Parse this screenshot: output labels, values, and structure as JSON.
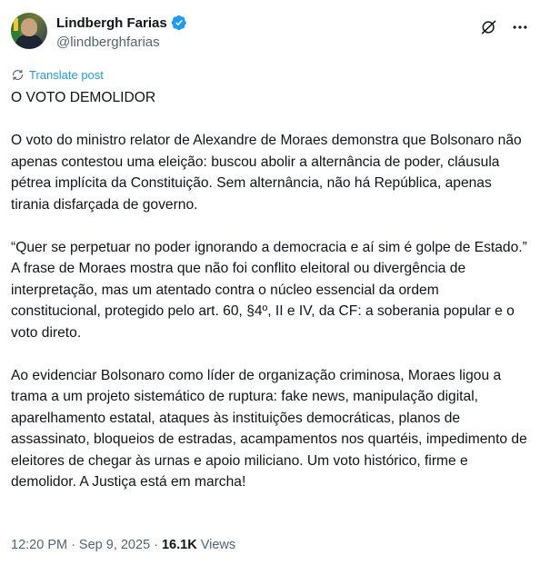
{
  "author": {
    "display_name": "Lindbergh Farias",
    "handle": "@lindberghfarias",
    "verified_color": "#1d9bf0"
  },
  "header_icons": {
    "grok": "grok-icon",
    "more": "more-icon"
  },
  "translate": {
    "label": "Translate post",
    "color": "#1d9bf0"
  },
  "post": {
    "paragraphs": [
      "O VOTO DEMOLIDOR",
      "O voto do ministro relator de Alexandre de Moraes demonstra que Bolsonaro não apenas contestou uma eleição: buscou abolir a alternância de poder, cláusula pétrea implícita da Constituição. Sem alternância, não há República, apenas tirania disfarçada de governo.",
      "“Quer se perpetuar no poder ignorando a democracia e aí sim é golpe de Estado.” A frase de Moraes mostra que não foi conflito eleitoral ou divergência de interpretação, mas um atentado contra o núcleo essencial da ordem constitucional, protegido pelo art. 60, §4º, II e IV, da CF: a soberania popular e o voto direto.",
      "Ao evidenciar Bolsonaro como líder de organização criminosa, Moraes ligou a trama a um projeto sistemático de ruptura: fake news, manipulação digital, aparelhamento estatal, ataques às instituições democráticas, planos de assassinato, bloqueios de estradas, acampamentos nos quartéis, impedimento de eleitores de chegar às urnas e apoio miliciano. Um voto histórico, firme e demolidor. A Justiça está em marcha!"
    ]
  },
  "meta": {
    "time": "12:20 PM",
    "separator": "·",
    "date": "Sep 9, 2025",
    "separator2": "·",
    "views_count": "16.1K",
    "views_label": "Views"
  }
}
